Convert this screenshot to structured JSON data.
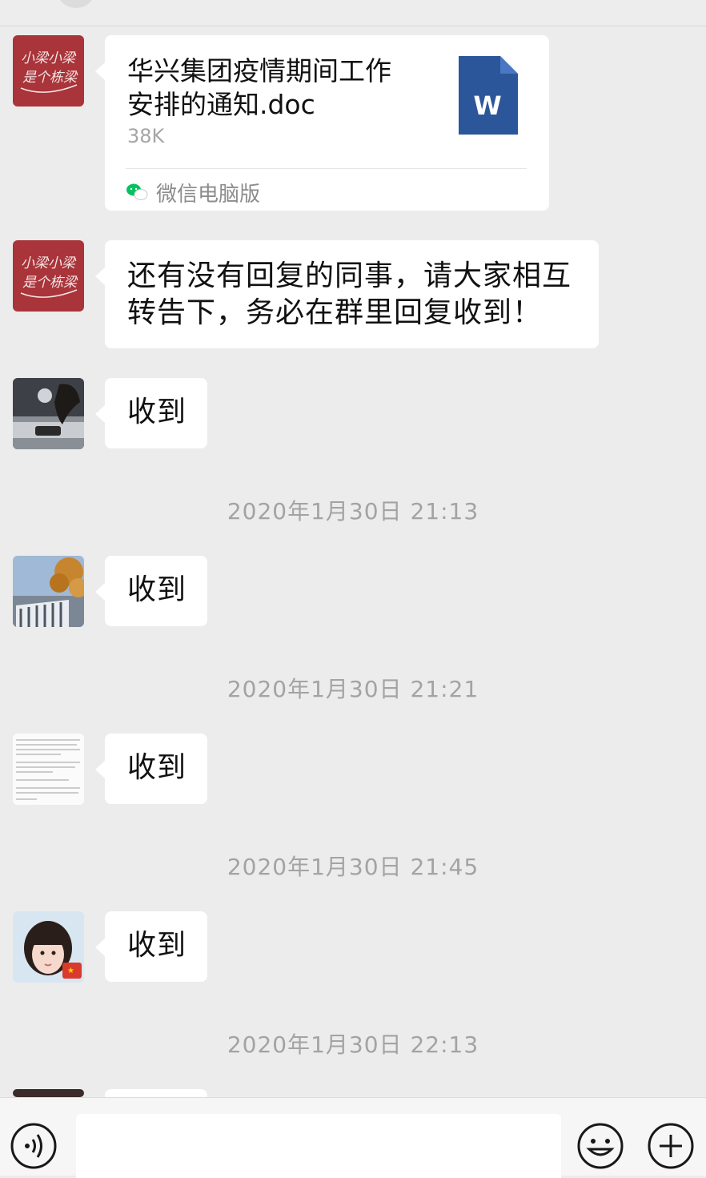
{
  "messages": [
    {
      "type": "file",
      "file": {
        "name": "华兴集团疫情期间工作安排的通知.doc",
        "name_line1": "华兴集团疫情期间工作",
        "name_line2": "安排的通知.doc",
        "size": "38K",
        "source": "微信电脑版",
        "icon_letter": "W",
        "icon_color": "#2b579a"
      },
      "avatar": {
        "icon": "handwritten-avatar",
        "lines": [
          "小梁小梁",
          "是个栋梁"
        ],
        "color": "#a9343a"
      }
    },
    {
      "type": "text",
      "line1": "还有没有回复的同事，请大家相互",
      "line2": "转告下，务必在群里回复收到！",
      "avatar": {
        "icon": "handwritten-avatar",
        "lines": [
          "小梁小梁",
          "是个栋梁"
        ],
        "color": "#a9343a"
      }
    },
    {
      "type": "text",
      "text": "收到",
      "avatar": {
        "icon": "car-photo-avatar"
      }
    },
    {
      "type": "text",
      "text": "收到",
      "avatar": {
        "icon": "building-tree-photo-avatar"
      }
    },
    {
      "type": "text",
      "text": "收到",
      "avatar": {
        "icon": "document-thumbnail-avatar"
      }
    },
    {
      "type": "text",
      "text": "收到",
      "avatar": {
        "icon": "girl-portrait-avatar"
      }
    }
  ],
  "timestamps": [
    "2020年1月30日 21:13",
    "2020年1月30日 21:21",
    "2020年1月30日 21:45",
    "2020年1月30日 22:13"
  ],
  "input": {
    "value": "",
    "voice_icon": "voice-icon",
    "emoji_icon": "emoji-icon",
    "plus_icon": "plus-icon"
  },
  "colors": {
    "background": "#ececec",
    "bubble": "#ffffff",
    "timestamp": "#a3a3a3",
    "wechat_green": "#07c160"
  }
}
